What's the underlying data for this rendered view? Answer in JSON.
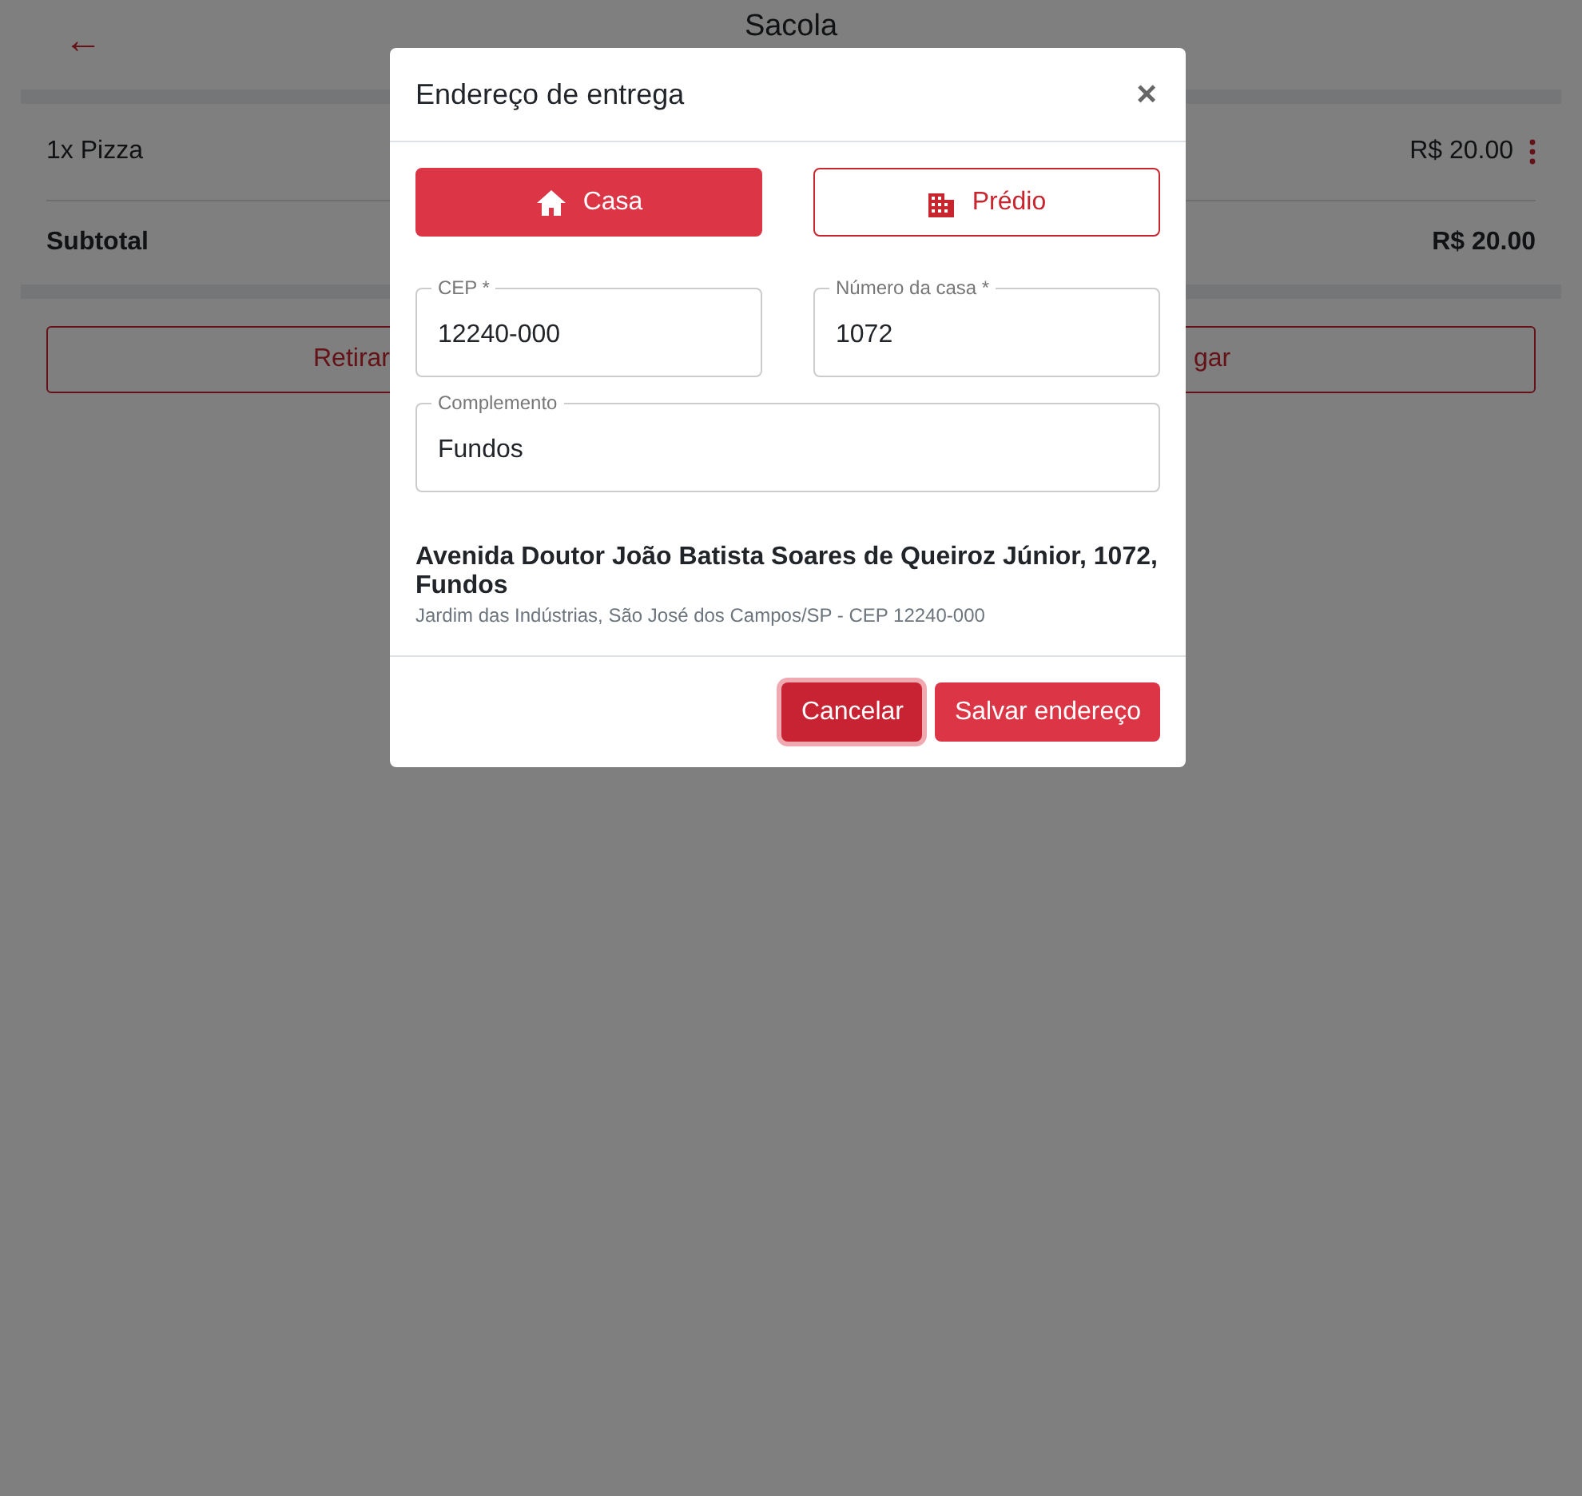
{
  "page": {
    "back_icon": "←",
    "title": "Sacola",
    "items": [
      {
        "name": "1x Pizza",
        "price": "R$ 20.00"
      }
    ],
    "subtotal": {
      "label": "Subtotal",
      "value": "R$ 20.00"
    },
    "actions": [
      "Retirar",
      "gar"
    ]
  },
  "dialog": {
    "title": "Endereço de entrega",
    "close": "×",
    "types": [
      {
        "kind": "house",
        "label": "Casa",
        "selected": true
      },
      {
        "kind": "building",
        "label": "Prédio",
        "selected": false
      }
    ],
    "fields": [
      {
        "label": "CEP *",
        "value": "12240-000"
      },
      {
        "label": "Número da casa *",
        "value": "1072"
      },
      {
        "label": "Complemento",
        "value": "Fundos"
      }
    ],
    "address": {
      "line1": "Avenida Doutor João Batista Soares de Queiroz Júnior, 1072, Fundos",
      "line2": "Jardim das Indústrias, São José dos Campos/SP - CEP 12240-000"
    },
    "buttons": [
      {
        "label": "Cancelar",
        "focused": true
      },
      {
        "label": "Salvar endereço",
        "focused": false
      }
    ]
  }
}
